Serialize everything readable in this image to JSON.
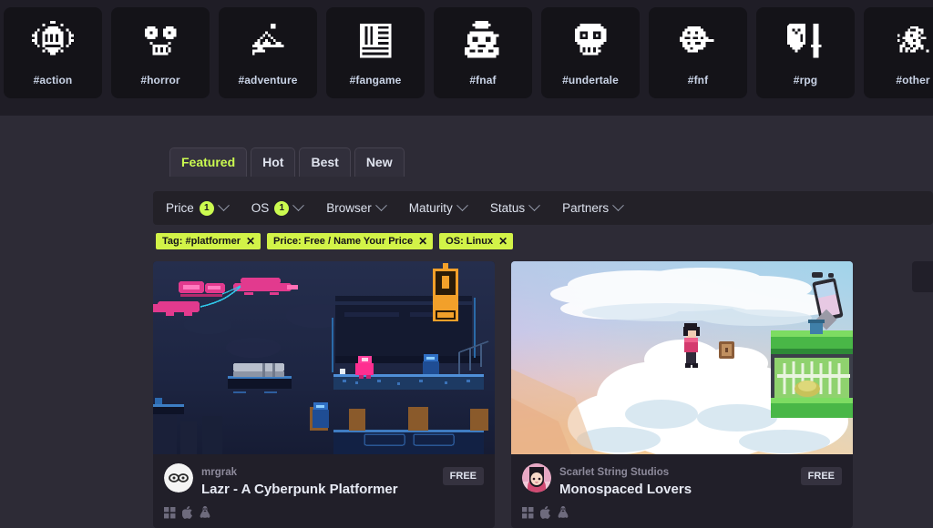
{
  "tag_strip": {
    "tags": [
      {
        "label": "#action",
        "icon": "fist-burst-icon"
      },
      {
        "label": "#horror",
        "icon": "skull-face-icon"
      },
      {
        "label": "#adventure",
        "icon": "mountain-icon"
      },
      {
        "label": "#fangame",
        "icon": "cabinet-icon"
      },
      {
        "label": "#fnaf",
        "icon": "animatronic-bear-icon"
      },
      {
        "label": "#undertale",
        "icon": "sans-skull-icon"
      },
      {
        "label": "#fnf",
        "icon": "boyfriend-icon"
      },
      {
        "label": "#rpg",
        "icon": "shield-sword-icon"
      },
      {
        "label": "#other",
        "icon": "pixel-blob-icon"
      }
    ]
  },
  "tabs": {
    "items": [
      {
        "label": "Featured",
        "active": true
      },
      {
        "label": "Hot",
        "active": false
      },
      {
        "label": "Best",
        "active": false
      },
      {
        "label": "New",
        "active": false
      }
    ]
  },
  "filter_bar": {
    "filters": [
      {
        "label": "Price",
        "count": "1"
      },
      {
        "label": "OS",
        "count": "1"
      },
      {
        "label": "Browser",
        "count": ""
      },
      {
        "label": "Maturity",
        "count": ""
      },
      {
        "label": "Status",
        "count": ""
      },
      {
        "label": "Partners",
        "count": ""
      }
    ]
  },
  "active_filters": {
    "chips": [
      {
        "label": "Tag: #platformer",
        "remove": "✕"
      },
      {
        "label": "Price: Free / Name Your Price",
        "remove": "✕"
      },
      {
        "label": "OS: Linux",
        "remove": "✕"
      }
    ]
  },
  "games": [
    {
      "author": "mrgrak",
      "title": "Lazr - A Cyberpunk Platformer",
      "price": "FREE",
      "platforms": [
        "windows-icon",
        "apple-icon",
        "linux-icon"
      ],
      "thumb_alt": "cyberpunk pixel-art city platformer screenshot"
    },
    {
      "author": "Scarlet String Studios",
      "title": "Monospaced Lovers",
      "price": "FREE",
      "platforms": [
        "windows-icon",
        "apple-icon",
        "linux-icon"
      ],
      "thumb_alt": "pixel-art character standing on clouds screenshot"
    }
  ],
  "colors": {
    "accent_green": "#cbfb50",
    "chip_green": "#d2f348",
    "header_bg": "#1f1d26",
    "page_bg": "#2d2b36",
    "card_bg": "#211f29",
    "filter_bg": "#232128"
  }
}
